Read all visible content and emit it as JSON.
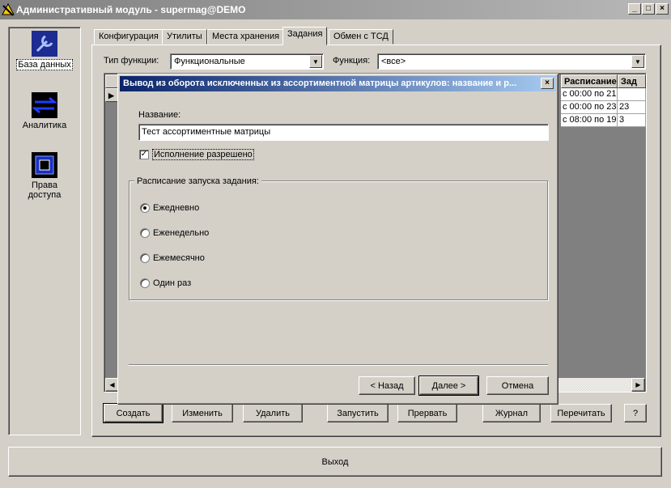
{
  "window": {
    "title": "Административный модуль - supermag@DEMO"
  },
  "sidebar": {
    "items": [
      {
        "label": "База данных",
        "icon": "wrench-icon"
      },
      {
        "label": "Аналитика",
        "icon": "arrows-icon"
      },
      {
        "label": "Права доступа",
        "icon": "access-icon"
      }
    ]
  },
  "tabs": [
    "Конфигурация",
    "Утилиты",
    "Места хранения",
    "Задания",
    "Обмен с ТСД"
  ],
  "filters": {
    "type_label": "Тип функции:",
    "type_value": "Функциональные",
    "function_label": "Функция:",
    "function_value": "<все>"
  },
  "grid": {
    "columns": [
      "Расписание",
      "Зад"
    ],
    "rows": [
      [
        "с 00:00 по 21",
        ""
      ],
      [
        "с 00:00 по 23",
        "23"
      ],
      [
        "с 08:00 по 19",
        "3"
      ]
    ]
  },
  "dialog": {
    "title": "Вывод из оборота исключенных из ассортиментной матрицы артикулов: название и р...",
    "name_label": "Название:",
    "name_value": "Тест ассортиментные матрицы",
    "enabled_label": "Исполнение разрешено",
    "enabled_checked": true,
    "schedule_group": "Расписание запуска задания:",
    "schedule_options": [
      "Ежедневно",
      "Еженедельно",
      "Ежемесячно",
      "Один раз"
    ],
    "schedule_selected": "Ежедневно",
    "back_button": "< Назад",
    "next_button": "Далее >",
    "cancel_button": "Отмена"
  },
  "toolbar": {
    "create": "Создать",
    "edit": "Изменить",
    "delete": "Удалить",
    "run": "Запустить",
    "stop": "Прервать",
    "log": "Журнал",
    "reread": "Перечитать",
    "help": "?"
  },
  "footer": {
    "exit": "Выход"
  }
}
